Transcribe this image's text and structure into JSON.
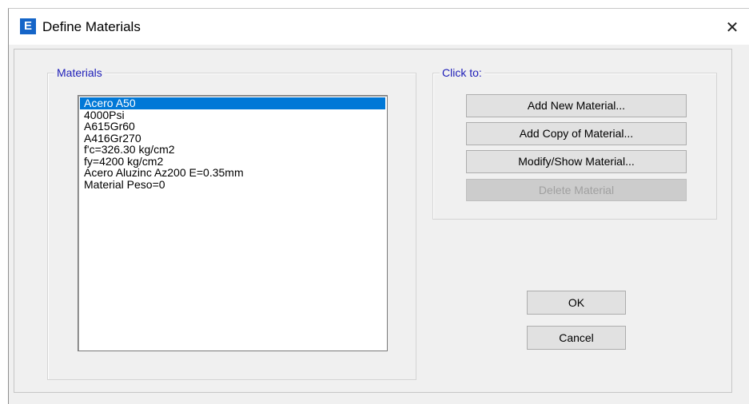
{
  "window": {
    "title": "Define Materials",
    "app_icon_letter": "E",
    "close_glyph": "✕"
  },
  "materials_group": {
    "label": "Materials",
    "items": [
      "Acero A50",
      "4000Psi",
      "A615Gr60",
      "A416Gr270",
      "f'c=326.30 kg/cm2",
      "fy=4200 kg/cm2",
      "Acero Aluzinc Az200 E=0.35mm",
      "Material Peso=0"
    ],
    "selected_index": 0
  },
  "click_to_group": {
    "label": "Click to:",
    "buttons": {
      "add_new": "Add New Material...",
      "add_copy": "Add Copy of Material...",
      "modify_show": "Modify/Show Material...",
      "delete": "Delete Material"
    }
  },
  "footer": {
    "ok": "OK",
    "cancel": "Cancel"
  },
  "colors": {
    "selection": "#0078d7",
    "group_label": "#1d1db8",
    "app_icon": "#1565c8"
  },
  "icons": {
    "app": "etabs-app-icon",
    "close": "close-icon"
  }
}
